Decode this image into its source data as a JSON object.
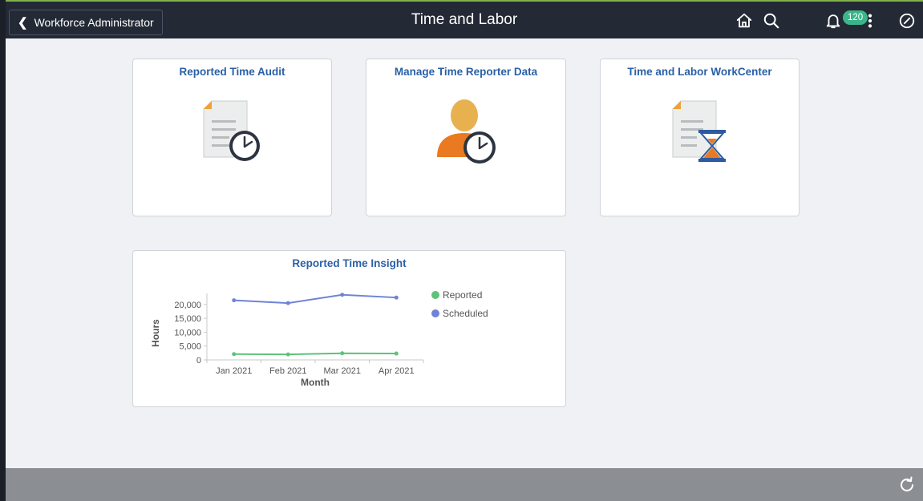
{
  "header": {
    "back_label": "Workforce Administrator",
    "title": "Time and Labor",
    "notification_count": "120"
  },
  "tiles": [
    {
      "title": "Reported Time Audit",
      "icon": "document-clock-icon"
    },
    {
      "title": "Manage Time Reporter Data",
      "icon": "person-clock-icon"
    },
    {
      "title": "Time and Labor WorkCenter",
      "icon": "document-hourglass-icon"
    }
  ],
  "insight_tile": {
    "title": "Reported Time Insight"
  },
  "chart_data": {
    "type": "line",
    "title": "Reported Time Insight",
    "xlabel": "Month",
    "ylabel": "Hours",
    "categories": [
      "Jan 2021",
      "Feb 2021",
      "Mar 2021",
      "Apr 2021"
    ],
    "yticks": [
      0,
      5000,
      10000,
      15000,
      20000
    ],
    "ytick_labels": [
      "0",
      "5,000",
      "10,000",
      "15,000",
      "20,000"
    ],
    "ylim": [
      0,
      24000
    ],
    "legend": "right",
    "series": [
      {
        "name": "Reported",
        "color": "#5cc37a",
        "values": [
          2100,
          2000,
          2400,
          2300
        ]
      },
      {
        "name": "Scheduled",
        "color": "#6f83d6",
        "values": [
          21500,
          20500,
          23500,
          22500
        ]
      }
    ]
  },
  "colors": {
    "accent": "#2a60a6",
    "header_bg": "#232935",
    "badge": "#3bb58a"
  }
}
